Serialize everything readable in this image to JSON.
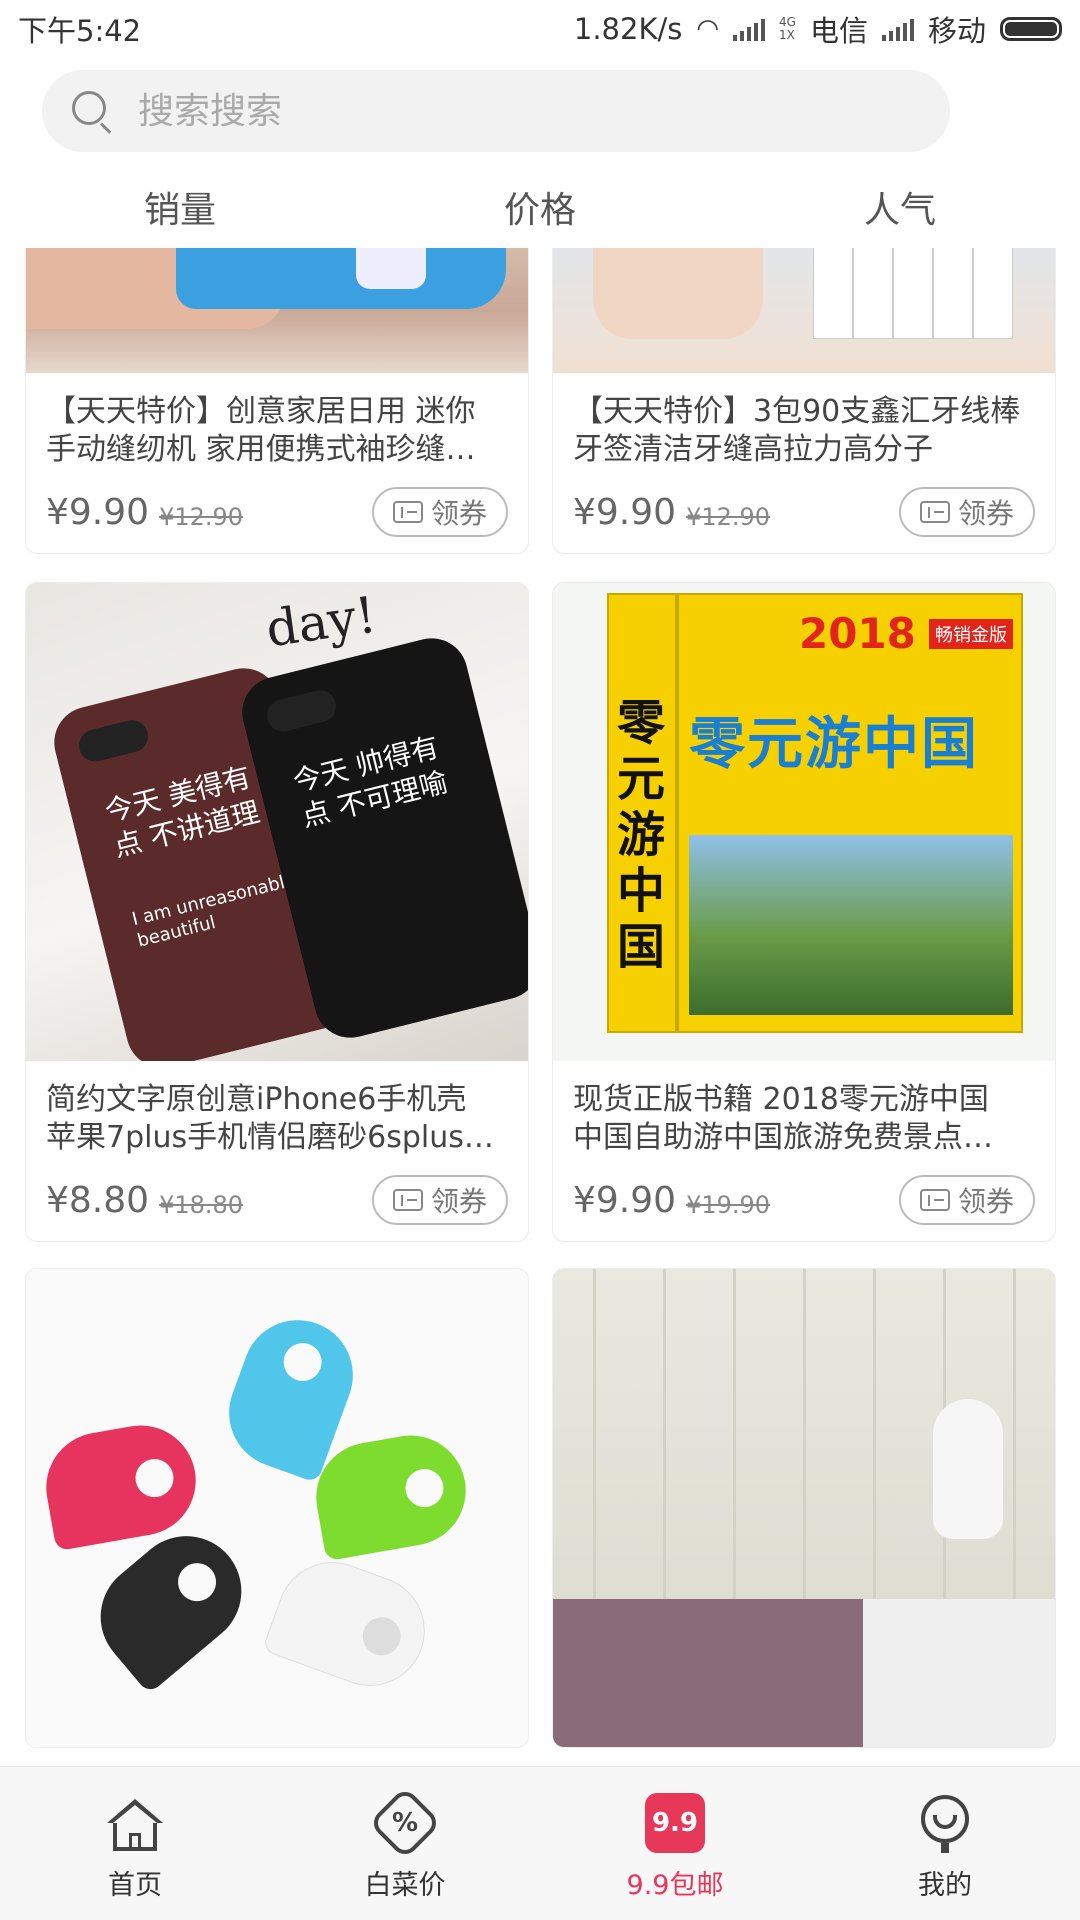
{
  "status_bar": {
    "time": "下午5:42",
    "speed": "1.82K/s",
    "net_type_top": "4G",
    "net_type_bottom": "1X",
    "carrier1": "电信",
    "carrier2": "移动"
  },
  "search": {
    "placeholder": "搜索搜索"
  },
  "sort_tabs": [
    "销量",
    "价格",
    "人气"
  ],
  "coupon_label": "领券",
  "products": [
    {
      "title_line1": "【天天特价】创意家居日用 迷你",
      "title_line2": "手动缝纫机 家用便携式袖珍缝…",
      "price": "¥9.90",
      "old_price": "¥12.90"
    },
    {
      "title_line1": "【天天特价】3包90支鑫汇牙线棒",
      "title_line2": "牙签清洁牙缝高拉力高分子",
      "price": "¥9.90",
      "old_price": "¥12.90"
    },
    {
      "title_line1": "简约文字原创意iPhone6手机壳",
      "title_line2": "苹果7plus手机情侣磨砂6splus…",
      "price": "¥8.80",
      "old_price": "¥18.80"
    },
    {
      "title_line1": "现货正版书籍 2018零元游中国",
      "title_line2": "中国自助游中国旅游免费景点…",
      "price": "¥9.90",
      "old_price": "¥19.90"
    }
  ],
  "images": {
    "phone_case_bg": "day!",
    "phone_case_red_text": "今天 美得有点 不讲道理",
    "phone_case_red_sub": "I am unreasonably beautiful",
    "phone_case_black_text": "今天 帅得有点 不可理喻",
    "book_year": "2018",
    "book_badge": "畅销金版",
    "book_title": "零元游中国",
    "book_spine": "零元游中国"
  },
  "bottom_nav": [
    {
      "label": "首页",
      "icon": "home-icon"
    },
    {
      "label": "白菜价",
      "icon": "discount-icon"
    },
    {
      "label": "9.9包邮",
      "icon": "bag-9.9-icon",
      "badge": "9.9"
    },
    {
      "label": "我的",
      "icon": "profile-icon"
    }
  ],
  "colors": {
    "accent": "#e8385a",
    "search_bg": "#f2f2f2"
  }
}
